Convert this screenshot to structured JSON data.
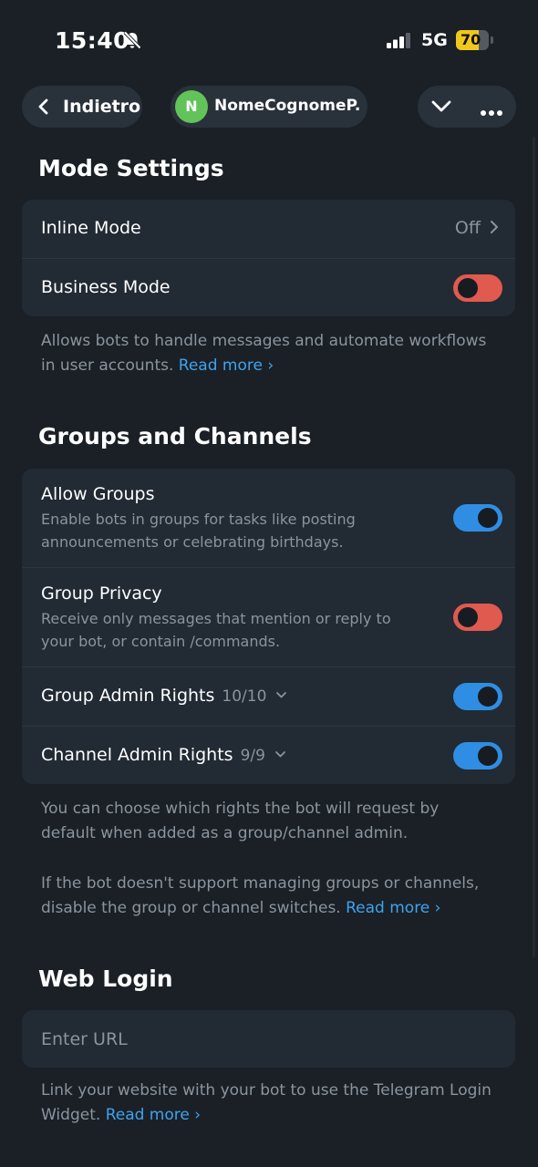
{
  "status_bar": {
    "time": "15:40",
    "network": "5G",
    "battery": "70",
    "battery_level": 0.7
  },
  "nav": {
    "back_label": "Indietro",
    "bot_avatar_letter": "N",
    "bot_name": "NomeCognomeP..."
  },
  "mode_settings": {
    "title": "Mode Settings",
    "inline_mode": {
      "label": "Inline Mode",
      "value": "Off"
    },
    "business_mode": {
      "label": "Business Mode",
      "enabled": false
    },
    "footnote": "Allows bots to handle messages and automate workflows in user accounts.",
    "read_more": "Read more ›"
  },
  "groups_channels": {
    "title": "Groups and Channels",
    "allow_groups": {
      "label": "Allow Groups",
      "description": "Enable bots in groups for tasks like posting announcements or celebrating birthdays.",
      "enabled": true
    },
    "group_privacy": {
      "label": "Group Privacy",
      "description": "Receive only messages that mention or reply to your bot, or contain /commands.",
      "enabled": false
    },
    "group_admin_rights": {
      "label": "Group Admin Rights",
      "count": "10/10",
      "enabled": true
    },
    "channel_admin_rights": {
      "label": "Channel Admin Rights",
      "count": "9/9",
      "enabled": true
    },
    "footnote1": "You can choose which rights the bot will request by default when added as a group/channel admin.",
    "footnote2": "If the bot doesn't support managing groups or channels, disable the group or channel switches.",
    "read_more": "Read more ›"
  },
  "web_login": {
    "title": "Web Login",
    "url_placeholder": "Enter URL",
    "footnote": "Link your website with your bot to use the Telegram Login Widget.",
    "read_more": "Read more ›"
  },
  "colors": {
    "background": "#1a2026",
    "card": "#222a33",
    "toggle_on": "#2f8ee3",
    "toggle_off": "#e05a4f",
    "link": "#3fa3f0"
  }
}
